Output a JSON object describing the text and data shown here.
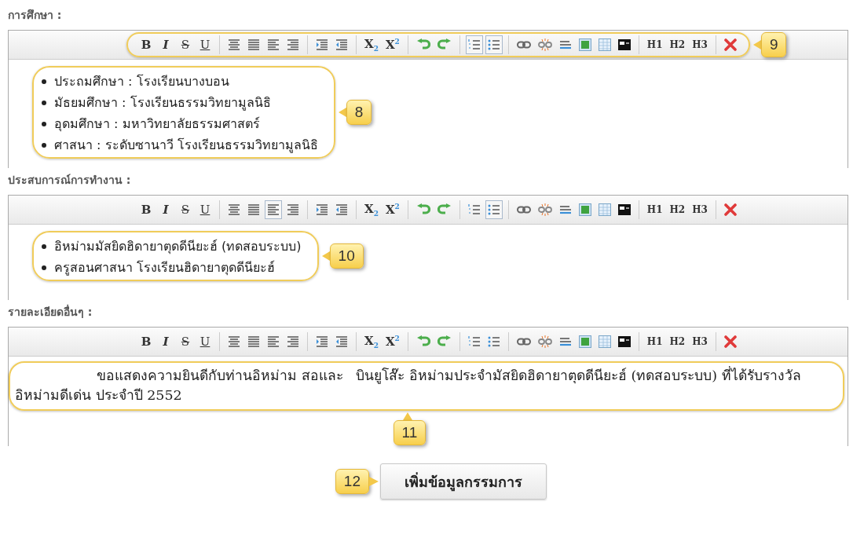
{
  "editors": [
    {
      "label": "การศึกษา :",
      "toolbar_callout": {
        "number": "9"
      },
      "toolbar": [
        [
          {
            "kind": "bold",
            "label": "B",
            "pressed": false
          },
          {
            "kind": "italic",
            "label": "I",
            "pressed": false
          },
          {
            "kind": "strike",
            "label": "S",
            "pressed": false
          },
          {
            "kind": "underline",
            "label": "U",
            "pressed": false
          }
        ],
        [
          {
            "kind": "align-center",
            "pressed": false
          },
          {
            "kind": "justify",
            "pressed": false
          },
          {
            "kind": "align-left",
            "pressed": false
          },
          {
            "kind": "align-right",
            "pressed": false
          }
        ],
        [
          {
            "kind": "indent",
            "pressed": false
          },
          {
            "kind": "outdent",
            "pressed": false
          }
        ],
        [
          {
            "kind": "subscript",
            "label": "X$_{2}$",
            "pressed": false
          },
          {
            "kind": "superscript",
            "label": "X$^{2}$",
            "pressed": false
          }
        ],
        [
          {
            "kind": "undo",
            "pressed": false
          },
          {
            "kind": "redo",
            "pressed": false
          }
        ],
        [
          {
            "kind": "ordered-list",
            "pressed": true
          },
          {
            "kind": "unordered-list",
            "pressed": true
          }
        ],
        [
          {
            "kind": "link",
            "pressed": false
          },
          {
            "kind": "unlink",
            "pressed": false
          },
          {
            "kind": "rule",
            "pressed": false
          },
          {
            "kind": "image",
            "pressed": false
          },
          {
            "kind": "table",
            "pressed": false
          },
          {
            "kind": "html",
            "pressed": false
          }
        ],
        [
          {
            "kind": "h1",
            "label": "H1",
            "pressed": false
          },
          {
            "kind": "h2",
            "label": "H2",
            "pressed": false
          },
          {
            "kind": "h3",
            "label": "H3",
            "pressed": false
          }
        ],
        [
          {
            "kind": "remove",
            "pressed": false
          }
        ]
      ],
      "content": {
        "kind": "list",
        "callout": {
          "number": "8"
        },
        "items": [
          "ประถมศึกษา : โรงเรียนบางบอน",
          "มัธยมศึกษา : โรงเรียนธรรมวิทยามูลนิธิ",
          "อุดมศึกษา : มหาวิทยาลัยธรรมศาสตร์",
          "ศาสนา : ระดับซานาวี โรงเรียนธรรมวิทยามูลนิธิ"
        ]
      }
    },
    {
      "label": "ประสบการณ์การทำงาน :",
      "toolbar": [
        [
          {
            "kind": "bold",
            "label": "B",
            "pressed": false
          },
          {
            "kind": "italic",
            "label": "I",
            "pressed": false
          },
          {
            "kind": "strike",
            "label": "S",
            "pressed": false
          },
          {
            "kind": "underline",
            "label": "U",
            "pressed": false
          }
        ],
        [
          {
            "kind": "align-center",
            "pressed": false
          },
          {
            "kind": "justify",
            "pressed": false
          },
          {
            "kind": "align-left",
            "pressed": true
          },
          {
            "kind": "align-right",
            "pressed": false
          }
        ],
        [
          {
            "kind": "indent",
            "pressed": false
          },
          {
            "kind": "outdent",
            "pressed": false
          }
        ],
        [
          {
            "kind": "subscript",
            "label": "X$_{2}$",
            "pressed": false
          },
          {
            "kind": "superscript",
            "label": "X$^{2}$",
            "pressed": false
          }
        ],
        [
          {
            "kind": "undo",
            "pressed": false
          },
          {
            "kind": "redo",
            "pressed": false
          }
        ],
        [
          {
            "kind": "ordered-list",
            "pressed": false
          },
          {
            "kind": "unordered-list",
            "pressed": true
          }
        ],
        [
          {
            "kind": "link",
            "pressed": false
          },
          {
            "kind": "unlink",
            "pressed": false
          },
          {
            "kind": "rule",
            "pressed": false
          },
          {
            "kind": "image",
            "pressed": false
          },
          {
            "kind": "table",
            "pressed": false
          },
          {
            "kind": "html",
            "pressed": false
          }
        ],
        [
          {
            "kind": "h1",
            "label": "H1",
            "pressed": false
          },
          {
            "kind": "h2",
            "label": "H2",
            "pressed": false
          },
          {
            "kind": "h3",
            "label": "H3",
            "pressed": false
          }
        ],
        [
          {
            "kind": "remove",
            "pressed": false
          }
        ]
      ],
      "content": {
        "kind": "list",
        "callout": {
          "number": "10"
        },
        "items": [
          "อิหม่ามมัสยิดฮิดายาตุดดีนียะฮ์ (ทดสอบระบบ)",
          "ครูสอนศาสนา โรงเรียนฮิดายาตุดดีนียะฮ์"
        ]
      }
    },
    {
      "label": "รายละเอียดอื่นๆ :",
      "toolbar": [
        [
          {
            "kind": "bold",
            "label": "B",
            "pressed": false
          },
          {
            "kind": "italic",
            "label": "I",
            "pressed": false
          },
          {
            "kind": "strike",
            "label": "S",
            "pressed": false
          },
          {
            "kind": "underline",
            "label": "U",
            "pressed": false
          }
        ],
        [
          {
            "kind": "align-center",
            "pressed": false
          },
          {
            "kind": "justify",
            "pressed": false
          },
          {
            "kind": "align-left",
            "pressed": false
          },
          {
            "kind": "align-right",
            "pressed": false
          }
        ],
        [
          {
            "kind": "indent",
            "pressed": false
          },
          {
            "kind": "outdent",
            "pressed": false
          }
        ],
        [
          {
            "kind": "subscript",
            "label": "X$_{2}$",
            "pressed": false
          },
          {
            "kind": "superscript",
            "label": "X$^{2}$",
            "pressed": false
          }
        ],
        [
          {
            "kind": "undo",
            "pressed": false
          },
          {
            "kind": "redo",
            "pressed": false
          }
        ],
        [
          {
            "kind": "ordered-list",
            "pressed": false
          },
          {
            "kind": "unordered-list",
            "pressed": false
          }
        ],
        [
          {
            "kind": "link",
            "pressed": false
          },
          {
            "kind": "unlink",
            "pressed": false
          },
          {
            "kind": "rule",
            "pressed": false
          },
          {
            "kind": "image",
            "pressed": false
          },
          {
            "kind": "table",
            "pressed": false
          },
          {
            "kind": "html",
            "pressed": false
          }
        ],
        [
          {
            "kind": "h1",
            "label": "H1",
            "pressed": false
          },
          {
            "kind": "h2",
            "label": "H2",
            "pressed": false
          },
          {
            "kind": "h3",
            "label": "H3",
            "pressed": false
          }
        ],
        [
          {
            "kind": "remove",
            "pressed": false
          }
        ]
      ],
      "content": {
        "kind": "paragraph",
        "callout": {
          "number": "11"
        },
        "text": "ขอแสดงความยินดีกับท่านอิหม่าม สอและ   บินยูโส๊ะ อิหม่ามประจำมัสยิดฮิดายาตุดดีนียะฮ์ (ทดสอบระบบ) ที่ได้รับรางวัลอิหม่ามดีเด่น ประจำปี 2552"
      }
    }
  ],
  "submit": {
    "label": "เพิ่มข้อมูลกรรมการ",
    "callout": {
      "number": "12"
    }
  }
}
